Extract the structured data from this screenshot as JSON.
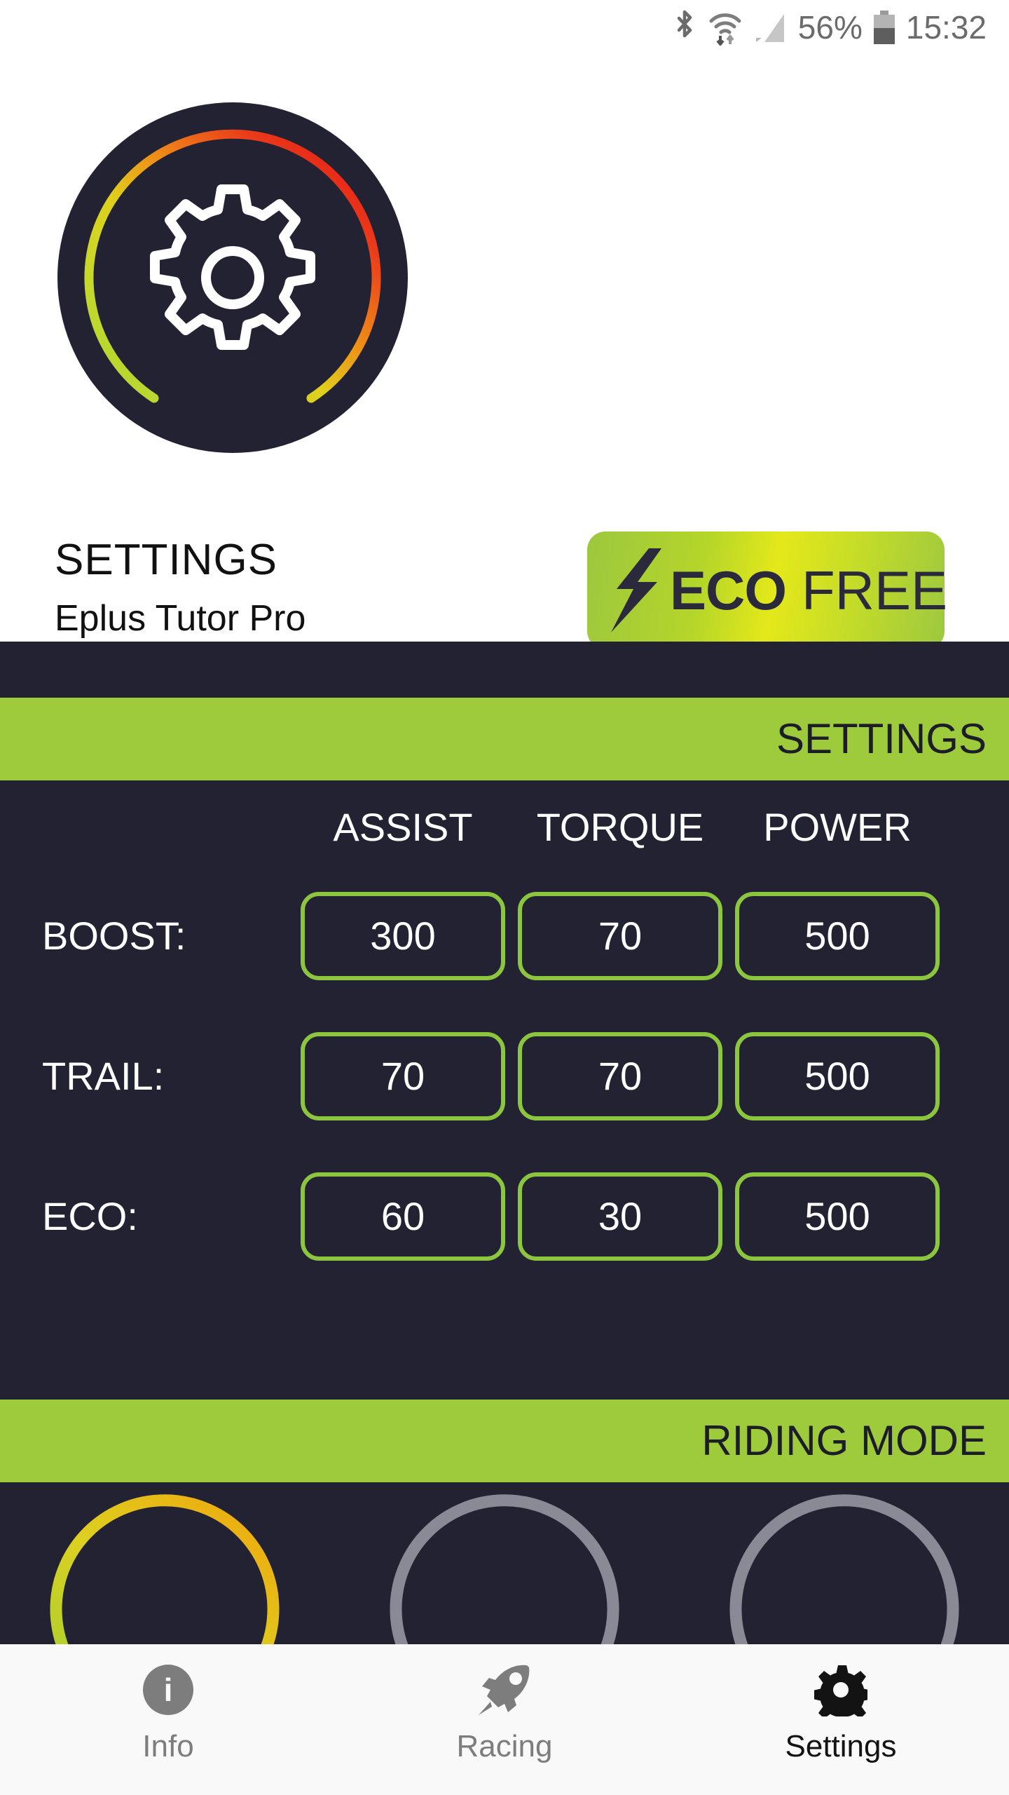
{
  "statusbar": {
    "bluetooth_icon": "bluetooth-icon",
    "wifi_icon": "wifi-icon",
    "signal_icon": "signal-icon",
    "battery_percent": "56%",
    "battery_icon": "battery-icon",
    "clock": "15:32"
  },
  "header": {
    "logo_icon": "gear-gauge-icon",
    "title": "SETTINGS",
    "subtitle": "Eplus Tutor Pro",
    "badge": {
      "bolt_icon": "lightning-bolt-icon",
      "eco": "ECO",
      "free": "FREE"
    }
  },
  "settings_section": {
    "bar_label": "SETTINGS",
    "columns": [
      "ASSIST",
      "TORQUE",
      "POWER"
    ],
    "rows": [
      {
        "label": "BOOST:",
        "values": [
          "300",
          "70",
          "500"
        ]
      },
      {
        "label": "TRAIL:",
        "values": [
          "70",
          "70",
          "500"
        ]
      },
      {
        "label": "ECO:",
        "values": [
          "60",
          "30",
          "500"
        ]
      }
    ]
  },
  "riding_section": {
    "bar_label": "RIDING MODE",
    "gauges": [
      {
        "name": "riding-mode-gauge-1",
        "active": true
      },
      {
        "name": "riding-mode-gauge-2",
        "active": false
      },
      {
        "name": "riding-mode-gauge-3",
        "active": false
      }
    ]
  },
  "bottomnav": {
    "items": [
      {
        "label": "Info",
        "icon": "info-icon",
        "active": false
      },
      {
        "label": "Racing",
        "icon": "rocket-icon",
        "active": false
      },
      {
        "label": "Settings",
        "icon": "gear-icon",
        "active": true
      }
    ]
  },
  "colors": {
    "dark": "#232233",
    "green": "#9ecb3c",
    "border_green": "#8cc63f",
    "badge_yellow": "#e4e81a",
    "nav_bg": "#f9f9f9"
  }
}
